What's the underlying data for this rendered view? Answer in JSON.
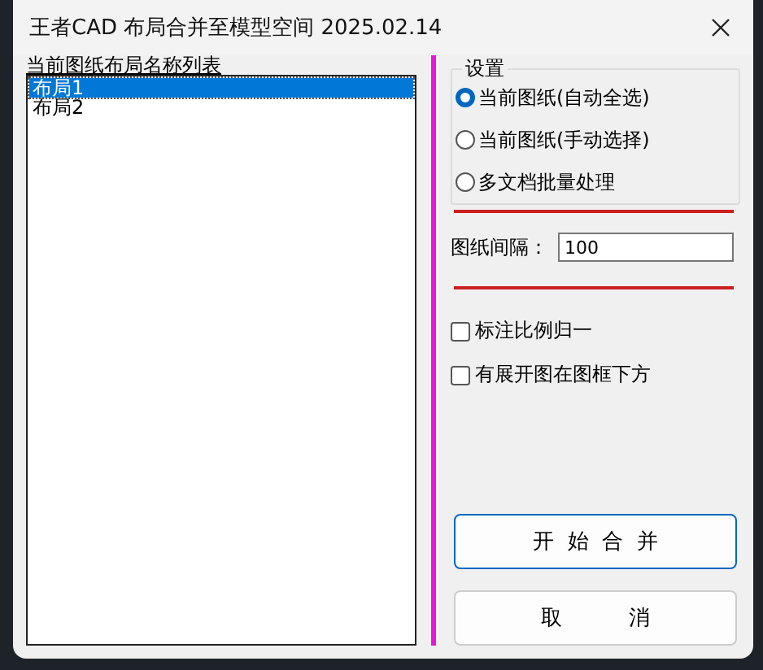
{
  "window": {
    "title": "王者CAD 布局合并至模型空间 2025.02.14"
  },
  "layout_list": {
    "label": "当前图纸布局名称列表",
    "items": [
      {
        "label": "布局1",
        "selected": true
      },
      {
        "label": "布局2",
        "selected": false
      }
    ]
  },
  "settings": {
    "title": "设置",
    "options": [
      {
        "label": "当前图纸(自动全选)",
        "selected": true
      },
      {
        "label": "当前图纸(手动选择)",
        "selected": false
      },
      {
        "label": "多文档批量处理",
        "selected": false
      }
    ]
  },
  "spacing": {
    "label": "图纸间隔：",
    "value": "100"
  },
  "checkboxes": [
    {
      "label": "标注比例归一",
      "checked": false
    },
    {
      "label": "有展开图在图框下方",
      "checked": false
    }
  ],
  "buttons": [
    {
      "label": "开  始  合  并",
      "kind": "primary"
    },
    {
      "label": "取          消",
      "kind": "normal"
    }
  ]
}
